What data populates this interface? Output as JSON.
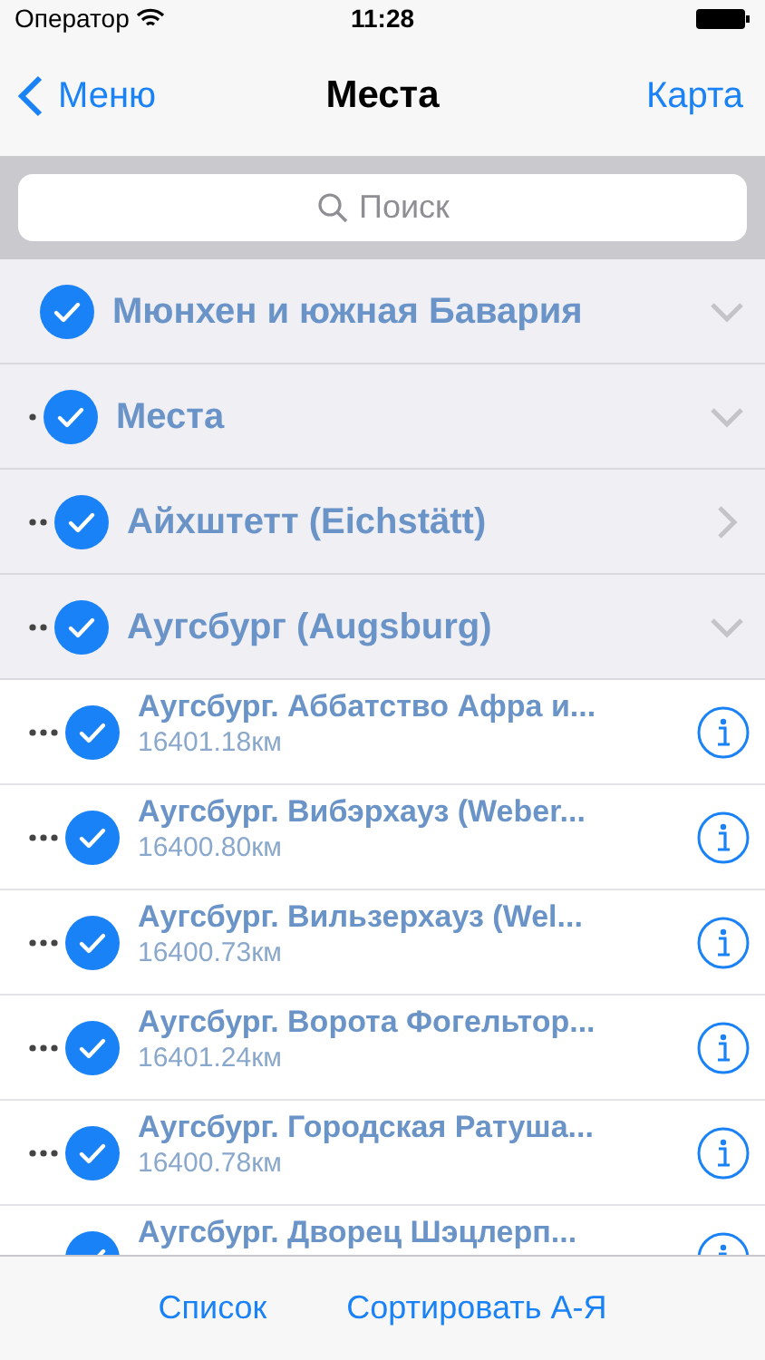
{
  "status_bar": {
    "carrier": "Оператор",
    "time": "11:28"
  },
  "nav": {
    "back": "Меню",
    "title": "Места",
    "action": "Карта"
  },
  "search": {
    "placeholder": "Поиск"
  },
  "tree": [
    {
      "kind": "group",
      "title": "Мюнхен и южная Бавария",
      "checked": true,
      "expanded": true,
      "children": [
        {
          "kind": "group",
          "title": "Места",
          "checked": true,
          "expanded": true,
          "children": [
            {
              "kind": "group",
              "title": "Айхштетт (Eichstätt)",
              "checked": true,
              "expanded": false
            },
            {
              "kind": "group",
              "title": "Аугсбург (Augsburg)",
              "checked": true,
              "expanded": true,
              "children": [
                {
                  "kind": "place",
                  "title": "Аугсбург. Аббатство Афра и...",
                  "distance": "16401.18км",
                  "checked": true
                },
                {
                  "kind": "place",
                  "title": "Аугсбург. Вибэрхауз (Weber...",
                  "distance": "16400.80км",
                  "checked": true
                },
                {
                  "kind": "place",
                  "title": "Аугсбург. Вильзерхауз (Wel...",
                  "distance": "16400.73км",
                  "checked": true
                },
                {
                  "kind": "place",
                  "title": "Аугсбург. Ворота Фогельтор...",
                  "distance": "16401.24км",
                  "checked": true
                },
                {
                  "kind": "place",
                  "title": "Аугсбург. Городская Ратуша...",
                  "distance": "16400.78км",
                  "checked": true
                },
                {
                  "kind": "place",
                  "title": "Аугсбург. Дворец Шэцлерп...",
                  "checked": true
                }
              ]
            }
          ]
        }
      ]
    }
  ],
  "toolbar": [
    "Список",
    "Сортировать А-Я"
  ]
}
